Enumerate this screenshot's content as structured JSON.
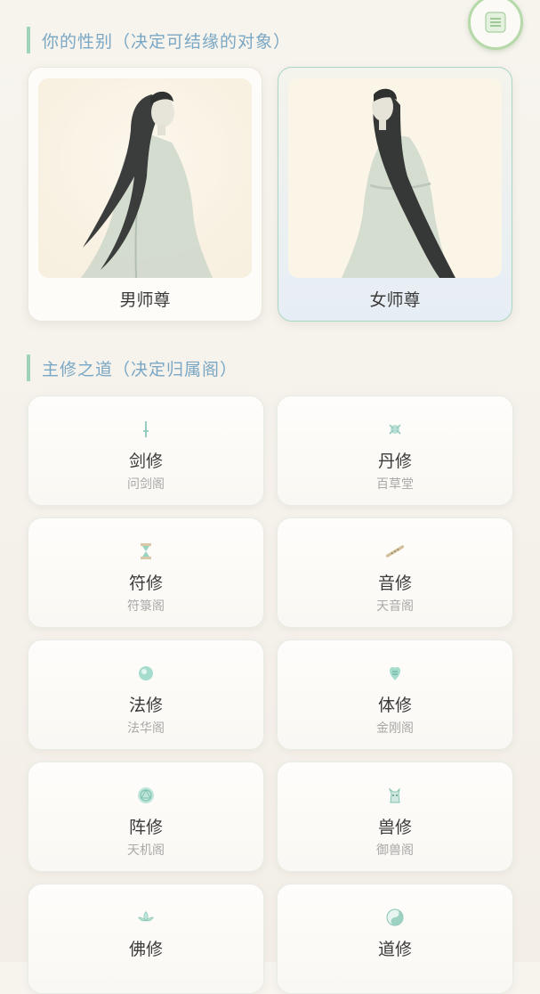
{
  "gender_section": {
    "title": "你的性别（决定可结缘的对象）",
    "options": [
      {
        "label": "男师尊",
        "selected": false
      },
      {
        "label": "女师尊",
        "selected": true
      }
    ]
  },
  "path_section": {
    "title": "主修之道（决定归属阁）",
    "paths": [
      {
        "name": "剑修",
        "sect": "问剑阁",
        "icon": "sword-icon"
      },
      {
        "name": "丹修",
        "sect": "百草堂",
        "icon": "herb-icon"
      },
      {
        "name": "符修",
        "sect": "符箓阁",
        "icon": "talisman-icon"
      },
      {
        "name": "音修",
        "sect": "天音阁",
        "icon": "flute-icon"
      },
      {
        "name": "法修",
        "sect": "法华阁",
        "icon": "orb-icon"
      },
      {
        "name": "体修",
        "sect": "金刚阁",
        "icon": "fist-icon"
      },
      {
        "name": "阵修",
        "sect": "天机阁",
        "icon": "formation-icon"
      },
      {
        "name": "兽修",
        "sect": "御兽阁",
        "icon": "beast-icon"
      },
      {
        "name": "佛修",
        "sect": "",
        "icon": "lotus-icon"
      },
      {
        "name": "道修",
        "sect": "",
        "icon": "taiji-icon"
      }
    ]
  },
  "colors": {
    "accent": "#9fd2b8",
    "title": "#7aa7c4",
    "selected_border": "#a9d7c3",
    "ink": "#6f7d74"
  },
  "menu_button": {
    "icon": "menu-icon"
  }
}
